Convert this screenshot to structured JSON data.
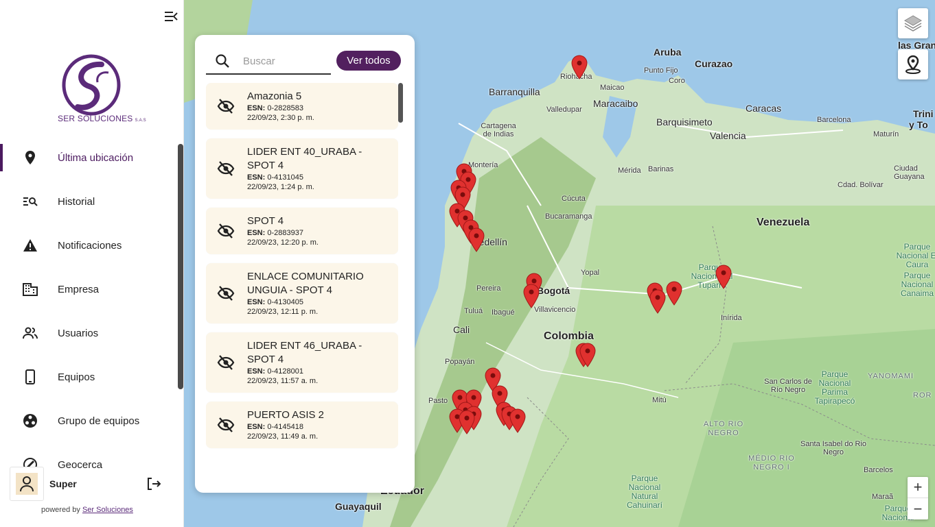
{
  "sidebar": {
    "logo_text": "SER SOLUCIONES",
    "logo_suffix": "S.A.S",
    "items": [
      {
        "label": "Última ubicación",
        "icon": "location-pin-icon",
        "active": true
      },
      {
        "label": "Historial",
        "icon": "history-search-icon",
        "active": false
      },
      {
        "label": "Notificaciones",
        "icon": "warning-icon",
        "active": false
      },
      {
        "label": "Empresa",
        "icon": "building-icon",
        "active": false
      },
      {
        "label": "Usuarios",
        "icon": "users-icon",
        "active": false
      },
      {
        "label": "Equipos",
        "icon": "phone-device-icon",
        "active": false
      },
      {
        "label": "Grupo de equipos",
        "icon": "group-icon",
        "active": false
      },
      {
        "label": "Geocerca",
        "icon": "geofence-icon",
        "active": false
      }
    ],
    "user_name": "Super",
    "powered_prefix": "powered by",
    "powered_link": "Ser Soluciones"
  },
  "panel": {
    "search_placeholder": "Buscar",
    "ver_todos_label": "Ver todos",
    "esn_label": "ESN:",
    "devices": [
      {
        "name": "Amazonia 5",
        "esn": "0-2828583",
        "time": "22/09/23, 2:30 p. m."
      },
      {
        "name": "LIDER ENT 40_URABA - SPOT 4",
        "esn": "0-4131045",
        "time": "22/09/23, 1:24 p. m."
      },
      {
        "name": "SPOT 4",
        "esn": "0-2883937",
        "time": "22/09/23, 12:20 p. m."
      },
      {
        "name": "ENLACE COMUNITARIO UNGUIA - SPOT 4",
        "esn": "0-4130405",
        "time": "22/09/23, 12:11 p. m."
      },
      {
        "name": "LIDER ENT 46_URABA - SPOT 4",
        "esn": "0-4128001",
        "time": "22/09/23, 11:57 a. m."
      },
      {
        "name": "PUERTO ASIS 2",
        "esn": "0-4145418",
        "time": "22/09/23, 11:49 a. m."
      }
    ]
  },
  "map": {
    "labels": {
      "aruba": "Aruba",
      "curazao": "Curazao",
      "las_gran": "las Gran",
      "punto_fijo": "Punto Fijo",
      "coro": "Coro",
      "riohacha": "Riohacha",
      "maicao": "Maicao",
      "barranquilla": "Barranquilla",
      "valledupar": "Valledupar",
      "maracaibo": "Maracaibo",
      "caracas": "Caracas",
      "barcelona": "Barcelona",
      "maturin": "Maturín",
      "trini": "Trini",
      "y_to": "y To",
      "cartagena": "Cartagena de Indias",
      "barquisimeto": "Barquisimeto",
      "valencia": "Valencia",
      "monteria": "Montería",
      "merida": "Mérida",
      "barinas": "Barinas",
      "ciudad_guayana": "Ciudad Guayana",
      "cdad_bolivar": "Cdad. Bolívar",
      "cucuta": "Cúcuta",
      "bucaramanga": "Bucaramanga",
      "venezuela": "Venezuela",
      "medellin": "Medellín",
      "yopal": "Yopal",
      "bogota": "Bogotá",
      "pereira": "Pereira",
      "ibague": "Ibagué",
      "villavicencio": "Villavicencio",
      "tulua": "Tuluá",
      "cali": "Cali",
      "colombia": "Colombia",
      "popayan": "Popayán",
      "pasto": "Pasto",
      "mitu": "Mitú",
      "inirida": "Inírida",
      "san_carlos": "San Carlos de Río Negro",
      "yanomami": "YANOMAMI",
      "ror": "ROR",
      "alto_rio": "ALTO RIO NEGRO",
      "medio_rio": "MÉDIO RIO NEGRO I",
      "santa_isabel": "Santa Isabel do Rio Negro",
      "barcelos": "Barcelos",
      "ecuador": "Ecuador",
      "guayaquil": "Guayaquil",
      "maraa": "Maraã",
      "park_caura": "Parque Nacional El Caura",
      "park_canaima": "Parque Nacional Canaima",
      "park_tuparro": "Parque Nacional El Tuparro",
      "park_parima": "Parque Nacional Parima Tapirapecó",
      "park_cahuinari": "Parque Nacional Natural Cahuinarí",
      "park_sur": "Parque Nacional"
    }
  },
  "colors": {
    "accent": "#52205f",
    "card_bg": "#fcf6e9",
    "pin": "#e0312f"
  }
}
